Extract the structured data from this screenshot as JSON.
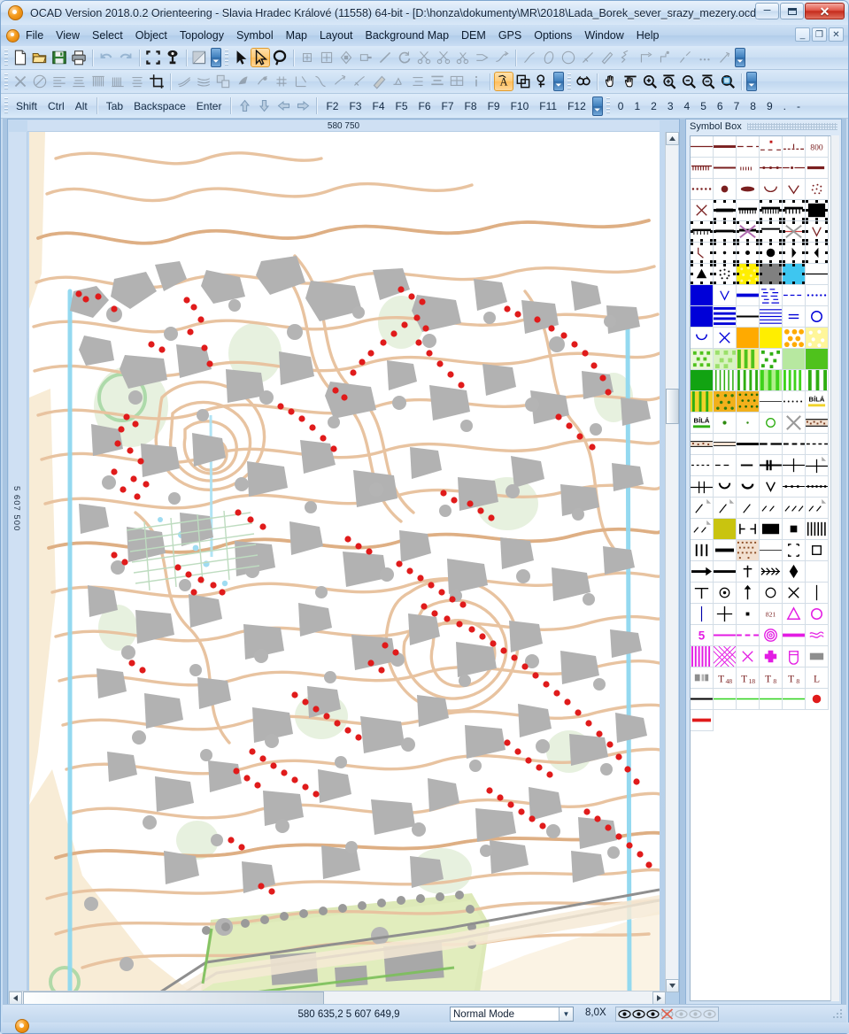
{
  "window": {
    "title": "OCAD Version 2018.0.2  Orienteering - Slavia Hradec Králové (11558) 64-bit - [D:\\honza\\dokumenty\\MR\\2018\\Lada_Borek_sever_srazy_mezery.ocd]",
    "minimize_label": "–",
    "maximize_label": "",
    "close_label": "✕",
    "mdi_minimize_label": "_",
    "mdi_restore_label": "❐",
    "mdi_close_label": "✕"
  },
  "menu": {
    "items": [
      {
        "label": "File"
      },
      {
        "label": "View"
      },
      {
        "label": "Select"
      },
      {
        "label": "Object"
      },
      {
        "label": "Topology"
      },
      {
        "label": "Symbol"
      },
      {
        "label": "Map"
      },
      {
        "label": "Layout"
      },
      {
        "label": "Background Map"
      },
      {
        "label": "DEM"
      },
      {
        "label": "GPS"
      },
      {
        "label": "Options"
      },
      {
        "label": "Window"
      },
      {
        "label": "Help"
      }
    ]
  },
  "toolbar_keys": {
    "modifier_keys": [
      "Shift",
      "Ctrl",
      "Alt"
    ],
    "edit_keys": [
      "Tab",
      "Backspace",
      "Enter"
    ],
    "arrow_keys": [
      "↑",
      "↓",
      "←",
      "→"
    ],
    "function_keys": [
      "F2",
      "F3",
      "F4",
      "F5",
      "F6",
      "F7",
      "F8",
      "F9",
      "F10",
      "F11",
      "F12"
    ],
    "numeric_keys": [
      "0",
      "1",
      "2",
      "3",
      "4",
      "5",
      "6",
      "7",
      "8",
      "9",
      ".",
      "-"
    ],
    "overflow_label": "⏷"
  },
  "toolbar_row1": {
    "icons": [
      {
        "name": "new-file-icon",
        "enabled": true
      },
      {
        "name": "open-file-icon",
        "enabled": true
      },
      {
        "name": "save-file-icon",
        "enabled": true
      },
      {
        "name": "print-icon",
        "enabled": true
      },
      {
        "name": "undo-icon",
        "enabled": false
      },
      {
        "name": "redo-icon",
        "enabled": false
      },
      {
        "name": "zoom-to-extent-icon",
        "enabled": true
      },
      {
        "name": "map-pin-icon",
        "enabled": true
      },
      {
        "name": "draft-mode-icon",
        "enabled": true
      },
      {
        "name": "select-arrow-icon",
        "enabled": true
      },
      {
        "name": "edit-point-arrow-icon",
        "enabled": true,
        "active": true
      },
      {
        "name": "lasso-select-icon",
        "enabled": true
      },
      {
        "name": "add-point-icon",
        "enabled": false
      },
      {
        "name": "add-corner-icon",
        "enabled": false
      },
      {
        "name": "move-point-icon",
        "enabled": false
      },
      {
        "name": "delete-point-icon",
        "enabled": false
      },
      {
        "name": "rotate-line-icon",
        "enabled": false
      },
      {
        "name": "rotate-object-icon",
        "enabled": false
      },
      {
        "name": "cut-object-icon",
        "enabled": false
      },
      {
        "name": "cut-hole-icon",
        "enabled": false
      },
      {
        "name": "scissors-icon",
        "enabled": false
      },
      {
        "name": "merge-icon",
        "enabled": false
      },
      {
        "name": "join-icon",
        "enabled": false
      },
      {
        "name": "draw-line-icon",
        "enabled": false
      },
      {
        "name": "draw-ellipse-icon",
        "enabled": false
      },
      {
        "name": "draw-circle-icon",
        "enabled": false
      },
      {
        "name": "draw-curve-icon",
        "enabled": false
      },
      {
        "name": "draw-bezier-icon",
        "enabled": false
      },
      {
        "name": "draw-zigzag-icon",
        "enabled": false
      },
      {
        "name": "draw-rect-line-icon",
        "enabled": false
      },
      {
        "name": "draw-polyline-icon",
        "enabled": false
      },
      {
        "name": "draw-freehand-icon",
        "enabled": false
      },
      {
        "name": "draw-dots-icon",
        "enabled": false
      },
      {
        "name": "draw-numeric-icon",
        "enabled": false
      }
    ]
  },
  "toolbar_row2": {
    "icons": [
      {
        "name": "delete-icon",
        "enabled": false
      },
      {
        "name": "fill-object-icon",
        "enabled": false
      },
      {
        "name": "align-left-icon",
        "enabled": false
      },
      {
        "name": "align-bottom-icon",
        "enabled": false
      },
      {
        "name": "parallel-lines-icon",
        "enabled": false
      },
      {
        "name": "wave-lines-icon",
        "enabled": false
      },
      {
        "name": "line-spacing-icon",
        "enabled": false
      },
      {
        "name": "crop-icon",
        "enabled": true
      },
      {
        "name": "smooth-object-icon",
        "enabled": false
      },
      {
        "name": "flatten-object-icon",
        "enabled": false
      },
      {
        "name": "duplicate-icon",
        "enabled": false
      },
      {
        "name": "rotate-fill-icon",
        "enabled": false
      },
      {
        "name": "cut-away-icon",
        "enabled": false
      },
      {
        "name": "gaps-icon",
        "enabled": false
      },
      {
        "name": "measure-angle-icon",
        "enabled": false
      },
      {
        "name": "curve-tool-icon",
        "enabled": false
      },
      {
        "name": "reshape-icon",
        "enabled": false
      },
      {
        "name": "simplify-icon",
        "enabled": false
      },
      {
        "name": "eraser-icon",
        "enabled": false
      },
      {
        "name": "text-edit-icon",
        "enabled": false
      },
      {
        "name": "indent-icon",
        "enabled": false
      },
      {
        "name": "indent-more-icon",
        "enabled": false
      },
      {
        "name": "table-icon",
        "enabled": false
      },
      {
        "name": "info-icon",
        "enabled": false
      },
      {
        "name": "text-object-icon",
        "enabled": true,
        "active": true
      },
      {
        "name": "duplicate-layer-icon",
        "enabled": true
      },
      {
        "name": "rotate-point-icon",
        "enabled": true
      },
      {
        "name": "find-icon",
        "enabled": true
      },
      {
        "name": "pan-hand-icon",
        "enabled": true
      },
      {
        "name": "pan-prev-icon",
        "enabled": true
      },
      {
        "name": "zoom-in-icon",
        "enabled": true
      },
      {
        "name": "zoom-in-prev-icon",
        "enabled": true
      },
      {
        "name": "zoom-out-icon",
        "enabled": true
      },
      {
        "name": "zoom-out-prev-icon",
        "enabled": true
      },
      {
        "name": "zoom-window-icon",
        "enabled": true
      }
    ]
  },
  "map_document": {
    "ruler_top_label": "580 750",
    "ruler_left_label": "5 607 500"
  },
  "symbol_panel": {
    "title": "Symbol Box"
  },
  "status_bar": {
    "coordinates": "580 635,2   5 607 649,9",
    "mode": "Normal Mode",
    "mode_options": [
      "Normal Mode"
    ],
    "zoom": "8,0X",
    "view_toggles": [
      {
        "name": "view-toggle-1",
        "state": "on"
      },
      {
        "name": "view-toggle-2",
        "state": "on"
      },
      {
        "name": "view-toggle-3",
        "state": "on"
      },
      {
        "name": "view-toggle-4",
        "state": "crossed"
      },
      {
        "name": "view-toggle-5",
        "state": "off"
      },
      {
        "name": "view-toggle-6",
        "state": "off"
      },
      {
        "name": "view-toggle-7",
        "state": "off"
      }
    ]
  },
  "colors": {
    "contour": "#e8c3a0",
    "contour_index": "#d9a878",
    "rock_gray": "#b0b0b0",
    "point_red": "#e01b1b",
    "water_blue": "#7fd4ef",
    "vegetation_green": "#cfe3b4",
    "open_yellow": "#f5e6c8",
    "accent_orange": "#f59b1c",
    "title_red": "#c52b1c",
    "symbol_brown": "#7a1f1f",
    "symbol_magenta": "#e31ce3",
    "symbol_blue": "#0000d8",
    "symbol_green": "#00a51e",
    "symbol_yellow": "#ffee00"
  }
}
